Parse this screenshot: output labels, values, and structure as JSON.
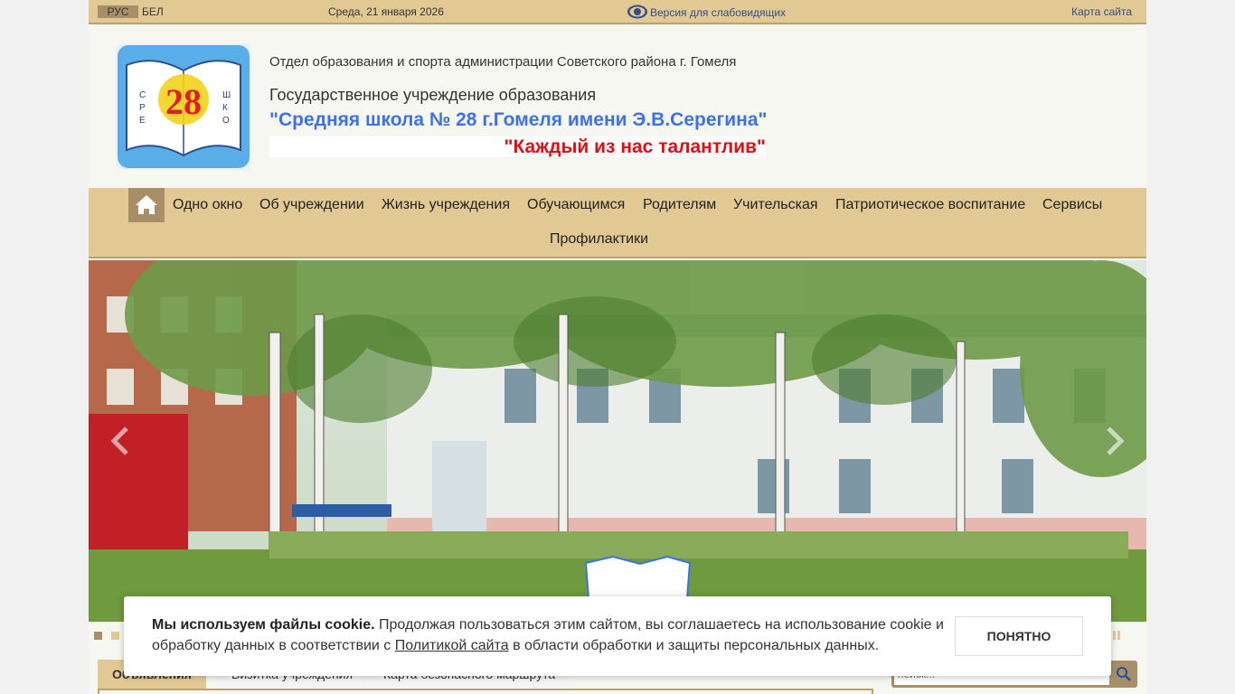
{
  "topbar": {
    "lang_active": "РУС",
    "lang_other": "БЕЛ",
    "date": "Среда, 21 января 2026",
    "low_vision": "Версия для слабовидящих",
    "sitemap": "Карта сайта"
  },
  "header": {
    "logo_text": "28",
    "organization": "Отдел образования и спорта  администрации Советского района г. Гомеля",
    "institution_type": "Государственное учреждение образования",
    "school_name": "\"Средняя школа № 28 г.Гомеля имени Э.В.Серегина\"",
    "motto": "\"Каждый из нас талантлив\""
  },
  "nav": {
    "items": [
      "Одно окно",
      "Об учреждении",
      "Жизнь учреждения",
      "Обучающимся",
      "Родителям",
      "Учительская",
      "Патриотическое воспитание",
      "Сервисы",
      "Профилактики"
    ]
  },
  "slider": {
    "dots": 2,
    "active_dot": 0
  },
  "tabs": [
    "Объявления",
    "Визитка учреждения",
    "Карта безопасного маршрута"
  ],
  "search": {
    "placeholder": "поиск..."
  },
  "cookie": {
    "bold": "Мы используем файлы cookie.",
    "text1": " Продолжая пользоваться этим сайтом, вы соглашаетесь на использование cookie и обработку данных в соответствии с ",
    "link": "Политикой сайта",
    "text2": " в области обработки и защиты персональных данных.",
    "button": "ПОНЯТНО"
  },
  "colors": {
    "bar": "#e2c994",
    "bar_dark": "#a88f68",
    "school_name": "#3d72e6",
    "motto": "#e10f14"
  }
}
